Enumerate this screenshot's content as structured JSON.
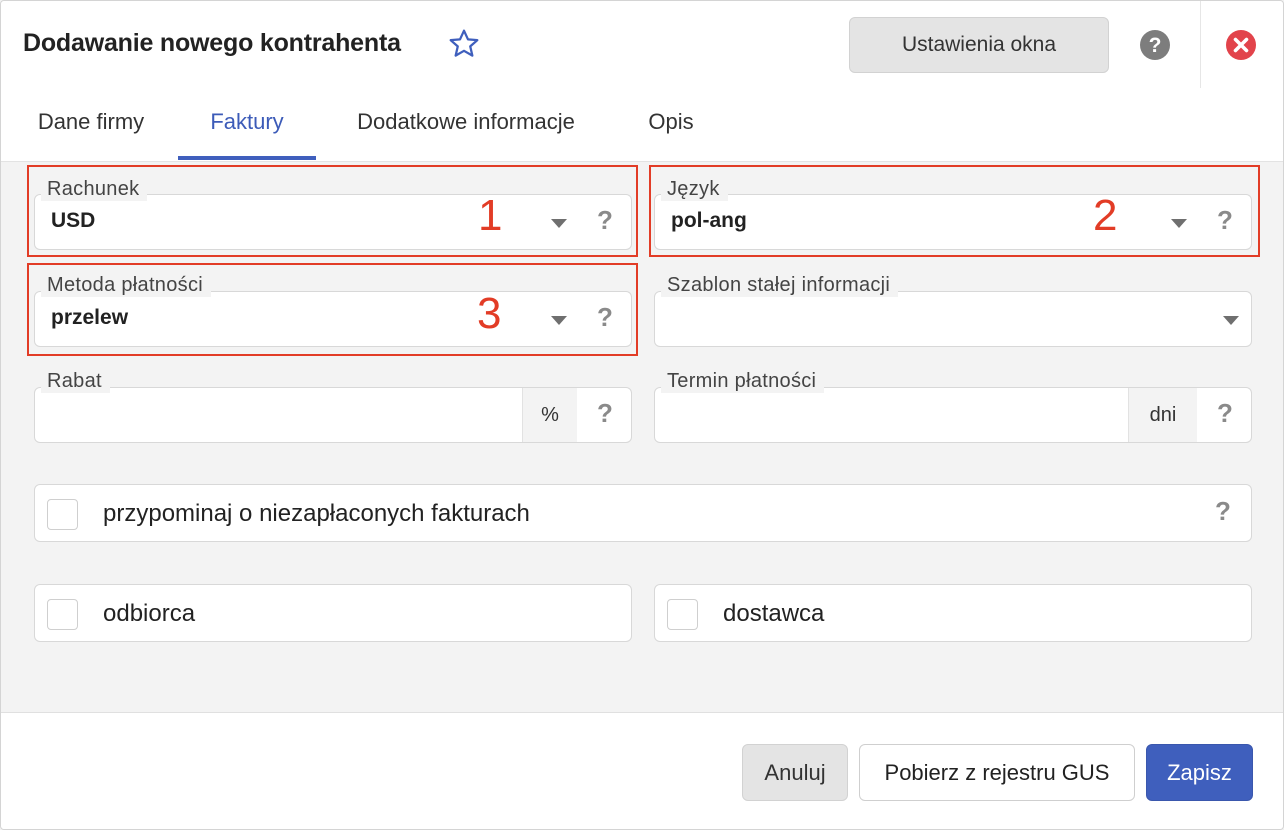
{
  "header": {
    "title": "Dodawanie nowego kontrahenta",
    "settings_label": "Ustawienia okna"
  },
  "tabs": [
    {
      "label": "Dane firmy",
      "active": false
    },
    {
      "label": "Faktury",
      "active": true
    },
    {
      "label": "Dodatkowe informacje",
      "active": false
    },
    {
      "label": "Opis",
      "active": false
    }
  ],
  "form": {
    "rachunek": {
      "label": "Rachunek",
      "value": "USD"
    },
    "jezyk": {
      "label": "Język",
      "value": "pol-ang"
    },
    "metoda": {
      "label": "Metoda płatności",
      "value": "przelew"
    },
    "szablon": {
      "label": "Szablon stałej informacji",
      "value": ""
    },
    "rabat": {
      "label": "Rabat",
      "value": "",
      "unit": "%"
    },
    "termin": {
      "label": "Termin płatności",
      "value": "",
      "unit": "dni"
    },
    "help_glyph": "?"
  },
  "checkboxes": {
    "remind": {
      "label": "przypominaj o niezapłaconych fakturach",
      "checked": false
    },
    "odbiorca": {
      "label": "odbiorca",
      "checked": false
    },
    "dostawca": {
      "label": "dostawca",
      "checked": false
    }
  },
  "annotations": [
    "1",
    "2",
    "3"
  ],
  "footer": {
    "cancel_label": "Anuluj",
    "gus_label": "Pobierz z rejestru GUS",
    "save_label": "Zapisz"
  },
  "colors": {
    "accent": "#3f5fbd",
    "annotation": "#e23c26",
    "close": "#e2434b"
  },
  "icons": [
    "star-icon",
    "help-circle-icon",
    "close-icon",
    "caret-down-icon",
    "question-icon"
  ]
}
